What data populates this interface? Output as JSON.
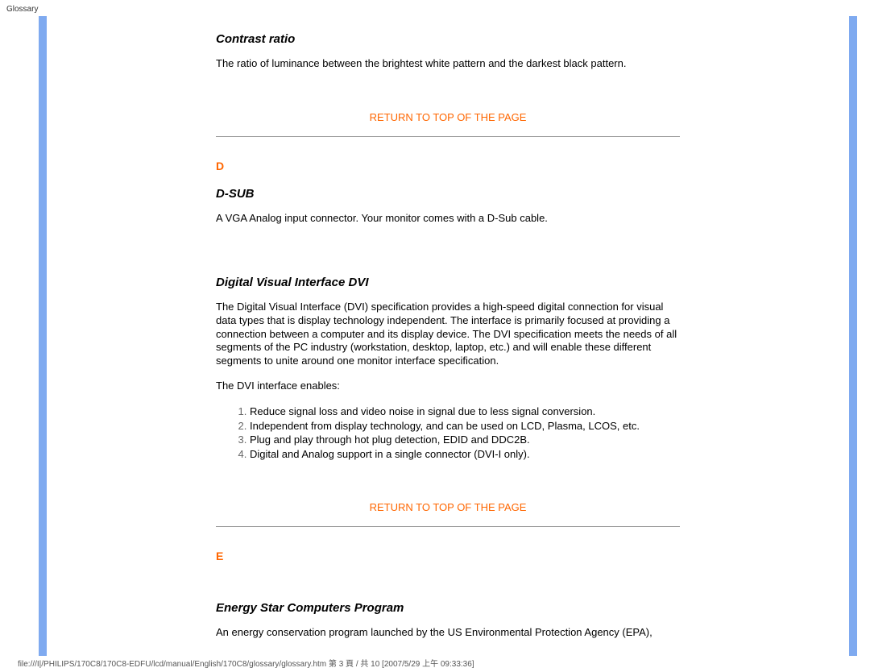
{
  "header": {
    "label": "Glossary"
  },
  "sections": {
    "contrast_ratio": {
      "title": "Contrast ratio",
      "body": "The ratio of luminance between the brightest white pattern and the darkest black pattern."
    },
    "return_link": "RETURN TO TOP OF THE PAGE",
    "letter_d": "D",
    "d_sub": {
      "title": "D-SUB",
      "body": "A VGA Analog input connector. Your monitor comes with a D-Sub cable."
    },
    "dvi": {
      "title": "Digital Visual Interface DVI",
      "body": "The Digital Visual Interface (DVI) specification provides a high-speed digital connection for visual data types that is display technology independent. The interface is primarily focused at providing a connection between a computer and its display device. The DVI specification meets the needs of all segments of the PC industry (workstation, desktop, laptop, etc.) and will enable these different segments to unite around one monitor interface specification.",
      "enables_intro": "The DVI interface enables:",
      "list": [
        "Reduce signal loss and video noise in signal due to less signal conversion.",
        "Independent from display technology, and can be used on LCD, Plasma, LCOS, etc.",
        "Plug and play through hot plug detection, EDID and DDC2B.",
        "Digital and Analog support in a single connector (DVI-I only)."
      ]
    },
    "letter_e": "E",
    "energy_star": {
      "title": "Energy Star Computers Program",
      "body": "An energy conservation program launched by the US Environmental Protection Agency (EPA),"
    }
  },
  "footer": {
    "text": "file:///I|/PHILIPS/170C8/170C8-EDFU/lcd/manual/English/170C8/glossary/glossary.htm 第 3 頁 / 共 10  [2007/5/29 上午 09:33:36]"
  }
}
